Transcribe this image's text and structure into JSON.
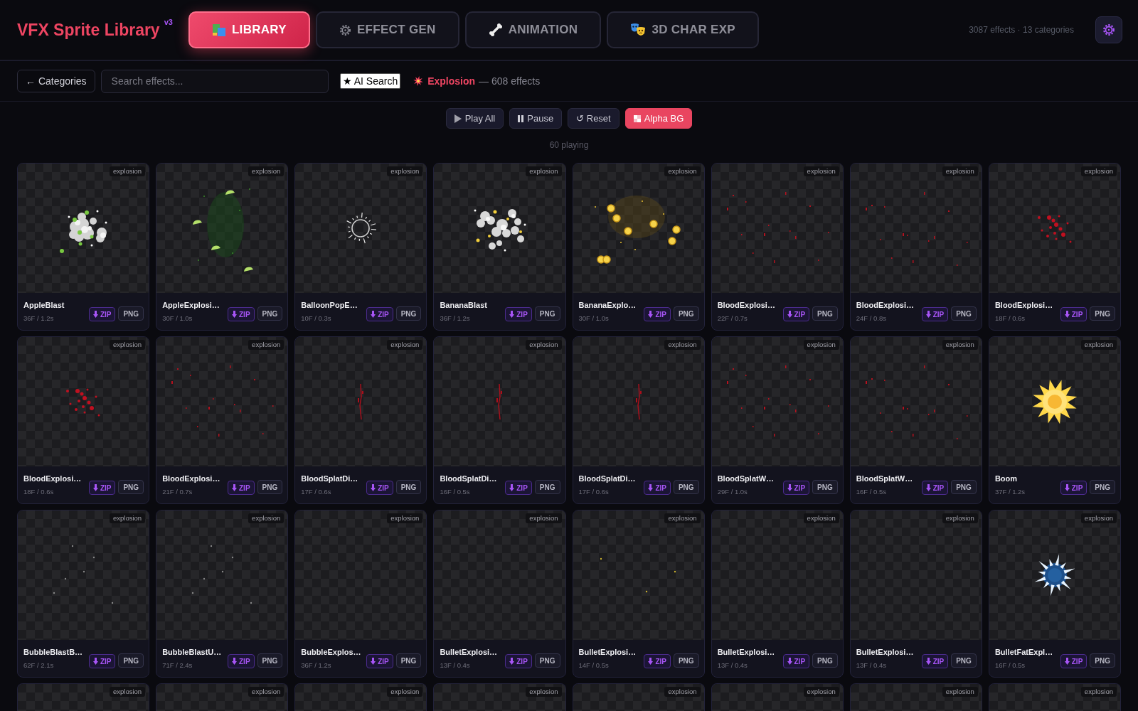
{
  "header": {
    "title": "VFX Sprite Library",
    "version": "v3",
    "tabs": [
      {
        "label": "LIBRARY",
        "selected": true
      },
      {
        "label": "EFFECT GEN",
        "selected": false
      },
      {
        "label": "ANIMATION",
        "selected": false
      },
      {
        "label": "3D CHAR EXP",
        "selected": false
      }
    ],
    "stats": "3087 effects · 13 categories"
  },
  "toolbar": {
    "back_button": "← Categories",
    "search": {
      "placeholder": "Search effects..."
    },
    "ai_button": "★ AI Search",
    "category": {
      "name": "Explosion",
      "count": "— 608 effects"
    }
  },
  "playback": {
    "buttons": [
      {
        "label": "Play All",
        "on": false
      },
      {
        "label": "Pause",
        "on": false
      },
      {
        "label": "↺ Reset",
        "on": false
      },
      {
        "label": "Alpha BG",
        "on": true
      }
    ],
    "status": "60 playing"
  },
  "cards": [
    {
      "name": "AppleBlast",
      "meta": "36F / 1.2s",
      "tag": "explosion",
      "kind": "cloud",
      "zip": "ZIP",
      "png": "PNG"
    },
    {
      "name": "AppleExplosi…",
      "meta": "30F / 1.0s",
      "tag": "explosion",
      "kind": "slices",
      "zip": "ZIP",
      "png": "PNG"
    },
    {
      "name": "BalloonPopE…",
      "meta": "10F / 0.3s",
      "tag": "explosion",
      "kind": "ring",
      "zip": "ZIP",
      "png": "PNG"
    },
    {
      "name": "BananaBlast",
      "meta": "36F / 1.2s",
      "tag": "explosion",
      "kind": "puffs",
      "zip": "ZIP",
      "png": "PNG"
    },
    {
      "name": "BananaExplo…",
      "meta": "30F / 1.0s",
      "tag": "explosion",
      "kind": "coins",
      "zip": "ZIP",
      "png": "PNG"
    },
    {
      "name": "BloodExplosi…",
      "meta": "22F / 0.7s",
      "tag": "explosion",
      "kind": "drops",
      "zip": "ZIP",
      "png": "PNG"
    },
    {
      "name": "BloodExplosi…",
      "meta": "24F / 0.8s",
      "tag": "explosion",
      "kind": "drops",
      "zip": "ZIP",
      "png": "PNG"
    },
    {
      "name": "BloodExplosi…",
      "meta": "18F / 0.6s",
      "tag": "explosion",
      "kind": "splatter",
      "zip": "ZIP",
      "png": "PNG"
    },
    {
      "name": "BloodExplosi…",
      "meta": "18F / 0.6s",
      "tag": "explosion",
      "kind": "splatter",
      "zip": "ZIP",
      "png": "PNG"
    },
    {
      "name": "BloodExplosi…",
      "meta": "21F / 0.7s",
      "tag": "explosion",
      "kind": "drops",
      "zip": "ZIP",
      "png": "PNG"
    },
    {
      "name": "BloodSplatDi…",
      "meta": "17F / 0.6s",
      "tag": "explosion",
      "kind": "streak",
      "zip": "ZIP",
      "png": "PNG"
    },
    {
      "name": "BloodSplatDi…",
      "meta": "16F / 0.5s",
      "tag": "explosion",
      "kind": "streak",
      "zip": "ZIP",
      "png": "PNG"
    },
    {
      "name": "BloodSplatDi…",
      "meta": "17F / 0.6s",
      "tag": "explosion",
      "kind": "streak",
      "zip": "ZIP",
      "png": "PNG"
    },
    {
      "name": "BloodSplatW…",
      "meta": "29F / 1.0s",
      "tag": "explosion",
      "kind": "drops",
      "zip": "ZIP",
      "png": "PNG"
    },
    {
      "name": "BloodSplatW…",
      "meta": "16F / 0.5s",
      "tag": "explosion",
      "kind": "drops",
      "zip": "ZIP",
      "png": "PNG"
    },
    {
      "name": "Boom",
      "meta": "37F / 1.2s",
      "tag": "explosion",
      "kind": "boom",
      "zip": "ZIP",
      "png": "PNG"
    },
    {
      "name": "BubbleBlastB…",
      "meta": "62F / 2.1s",
      "tag": "explosion",
      "kind": "specks",
      "zip": "ZIP",
      "png": "PNG"
    },
    {
      "name": "BubbleBlastU…",
      "meta": "71F / 2.4s",
      "tag": "explosion",
      "kind": "specks",
      "zip": "ZIP",
      "png": "PNG"
    },
    {
      "name": "BubbleExplos…",
      "meta": "36F / 1.2s",
      "tag": "explosion",
      "kind": "empty",
      "zip": "ZIP",
      "png": "PNG"
    },
    {
      "name": "BulletExplosi…",
      "meta": "13F / 0.4s",
      "tag": "explosion",
      "kind": "empty",
      "zip": "ZIP",
      "png": "PNG"
    },
    {
      "name": "BulletExplosi…",
      "meta": "14F / 0.5s",
      "tag": "explosion",
      "kind": "sparks",
      "zip": "ZIP",
      "png": "PNG"
    },
    {
      "name": "BulletExplosi…",
      "meta": "13F / 0.4s",
      "tag": "explosion",
      "kind": "empty",
      "zip": "ZIP",
      "png": "PNG"
    },
    {
      "name": "BulletExplosi…",
      "meta": "13F / 0.4s",
      "tag": "explosion",
      "kind": "empty",
      "zip": "ZIP",
      "png": "PNG"
    },
    {
      "name": "BulletFatExpl…",
      "meta": "16F / 0.5s",
      "tag": "explosion",
      "kind": "spikes",
      "zip": "ZIP",
      "png": "PNG"
    },
    {
      "tag": "explosion"
    },
    {
      "tag": "explosion"
    },
    {
      "tag": "explosion"
    },
    {
      "tag": "explosion"
    },
    {
      "tag": "explosion"
    },
    {
      "tag": "explosion"
    },
    {
      "tag": "explosion"
    },
    {
      "tag": "explosion"
    }
  ]
}
